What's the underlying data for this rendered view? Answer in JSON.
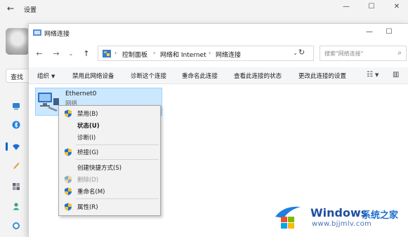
{
  "settings": {
    "title": "设置",
    "search_label": "查找"
  },
  "window": {
    "title": "网络连接"
  },
  "address": {
    "crumbs": [
      "控制面板",
      "网络和 Internet",
      "网络连接"
    ],
    "search_placeholder": "搜索\"网络连接\""
  },
  "commands": {
    "organize": "组织",
    "disable": "禁用此网络设备",
    "diagnose": "诊断这个连接",
    "rename": "重命名此连接",
    "view_status": "查看此连接的状态",
    "change_settings": "更改此连接的设置"
  },
  "network_item": {
    "name": "Ethernet0",
    "type": "网络"
  },
  "context_menu": [
    {
      "label": "禁用(B)",
      "shield": true,
      "bold": false,
      "disabled": false
    },
    {
      "label": "状态(U)",
      "shield": false,
      "bold": true,
      "disabled": false
    },
    {
      "label": "诊断(I)",
      "shield": false,
      "bold": false,
      "disabled": false
    },
    {
      "label": "桥接(G)",
      "shield": true,
      "bold": false,
      "disabled": false
    },
    {
      "label": "创建快捷方式(S)",
      "shield": false,
      "bold": false,
      "disabled": false
    },
    {
      "label": "删除(D)",
      "shield": true,
      "bold": false,
      "disabled": true
    },
    {
      "label": "重命名(M)",
      "shield": true,
      "bold": false,
      "disabled": false
    },
    {
      "label": "属性(R)",
      "shield": true,
      "bold": false,
      "disabled": false
    }
  ],
  "watermark": {
    "brand": "Windows",
    "brand_cn": "系统之家",
    "url": "www.bjjmlv.com"
  },
  "colors": {
    "accent": "#0067c0",
    "selection": "#cce8ff",
    "selection_border": "#99d1ff",
    "menu_bg": "#f2f2f2"
  }
}
